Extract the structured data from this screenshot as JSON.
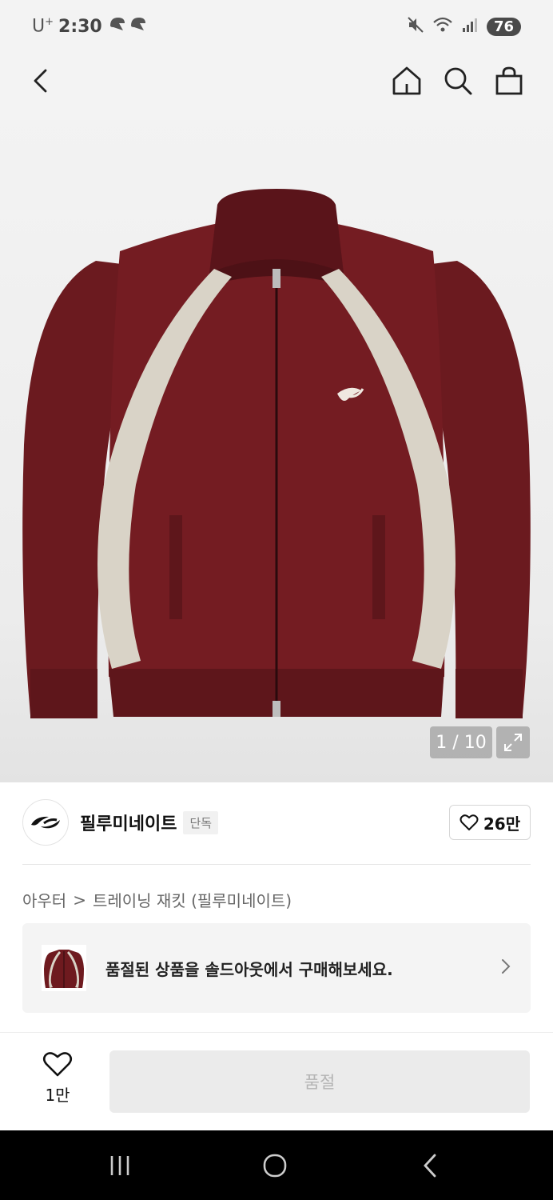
{
  "status_bar": {
    "carrier": "U",
    "carrier_sup": "+",
    "time": "2:30",
    "battery": "76"
  },
  "gallery": {
    "page_indicator": "1 / 10",
    "colors": {
      "body": "#6e1a1f",
      "stripe": "#d9d3c7"
    }
  },
  "brand": {
    "name": "필루미네이트",
    "badge": "단독",
    "like_count": "26만"
  },
  "breadcrumb": {
    "category": "아우터",
    "separator": ">",
    "product": "트레이닝 재킷 (필루미네이트)"
  },
  "promo": {
    "text": "품절된 상품을 솔드아웃에서 구매해보세요."
  },
  "bottom_bar": {
    "wish_count": "1만",
    "action_label": "품절"
  }
}
